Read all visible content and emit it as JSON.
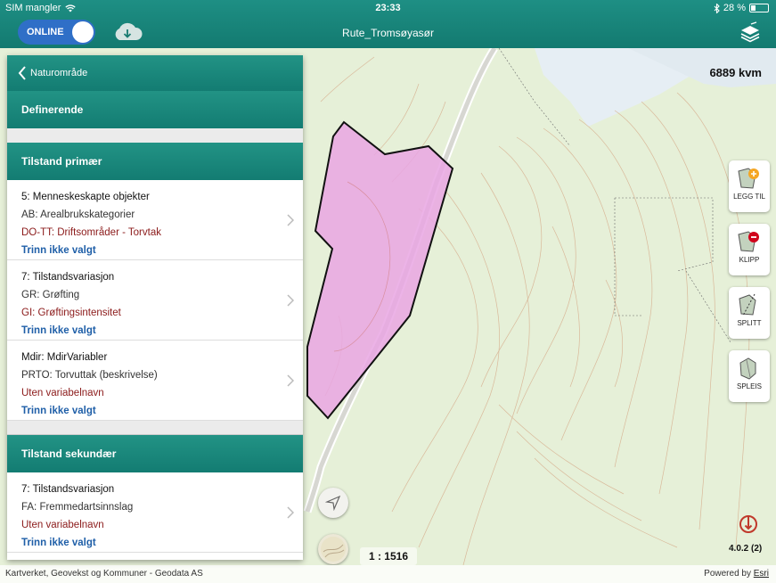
{
  "status": {
    "carrier": "SIM mangler",
    "time": "23:33",
    "battery": "28 %"
  },
  "header": {
    "toggle_label": "ONLINE",
    "title": "Rute_Tromsøyasør"
  },
  "map": {
    "area": "6889 kvm",
    "scale": "1 : 1516",
    "version": "4.0.2 (2)"
  },
  "tools": [
    {
      "label": "LEGG TIL",
      "icon": "add-polygon-icon"
    },
    {
      "label": "KLIPP",
      "icon": "cut-polygon-icon"
    },
    {
      "label": "SPLITT",
      "icon": "split-polygon-icon"
    },
    {
      "label": "SPLEIS",
      "icon": "merge-polygon-icon"
    }
  ],
  "panel": {
    "back_label": "Naturområde",
    "definerende": "Definerende",
    "primary_header": "Tilstand primær",
    "primary_items": [
      {
        "line1": "5: Menneskeskapte objekter",
        "line2": "AB: Arealbrukskategorier",
        "line3": "DO-TT: Driftsområder - Torvtak",
        "line4": "Trinn ikke valgt"
      },
      {
        "line1": "7: Tilstandsvariasjon",
        "line2": "GR: Grøfting",
        "line3": "GI: Grøftingsintensitet",
        "line4": "Trinn ikke valgt"
      },
      {
        "line1": "Mdir: MdirVariabler",
        "line2": "PRTO: Torvuttak (beskrivelse)",
        "line3": "Uten variabelnavn",
        "line4": "Trinn ikke valgt"
      }
    ],
    "secondary_header": "Tilstand sekundær",
    "secondary_items": [
      {
        "line1": "7: Tilstandsvariasjon",
        "line2": "FA: Fremmedartsinnslag",
        "line3": "Uten variabelnavn",
        "line4": "Trinn ikke valgt"
      }
    ]
  },
  "attribution": {
    "left": "Kartverket, Geovekst og Kommuner - Geodata AS",
    "powered": "Powered by",
    "esri": "Esri"
  },
  "colors": {
    "teal": "#1a887d",
    "polygon_fill": "#e9a6e3",
    "map_bg": "#e6f0d8",
    "link_blue": "#1f5fa8",
    "variable_red": "#8b1a1a"
  }
}
